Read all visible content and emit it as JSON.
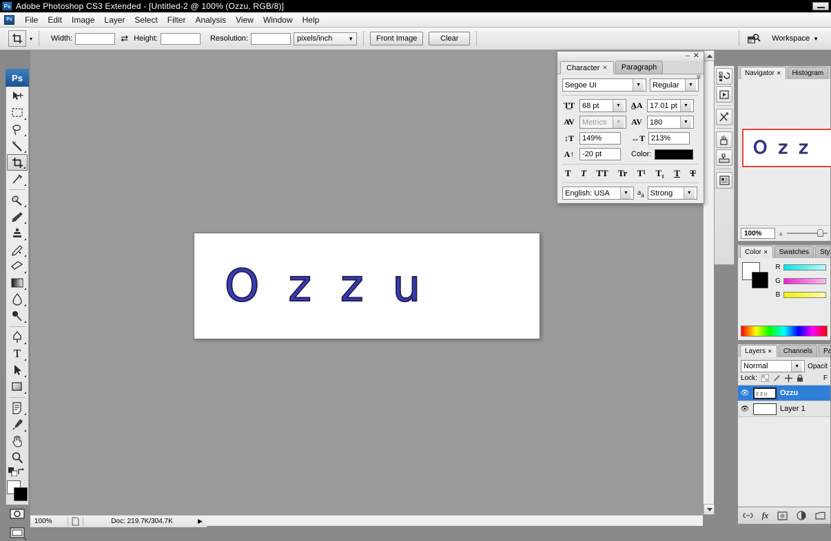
{
  "titlebar": {
    "logo": "Ps",
    "title": "Adobe Photoshop CS3 Extended - [Untitled-2 @ 100% (Ozzu, RGB/8)]",
    "minimize": "minimize-icon"
  },
  "menubar": {
    "logo": "Ps",
    "items": [
      "File",
      "Edit",
      "Image",
      "Layer",
      "Select",
      "Filter",
      "Analysis",
      "View",
      "Window",
      "Help"
    ]
  },
  "options_bar": {
    "tool_icon": "crop-tool-icon",
    "tool_caret": "▾",
    "width_label": "Width:",
    "width_value": "",
    "swap_icon": "⇄",
    "height_label": "Height:",
    "height_value": "",
    "resolution_label": "Resolution:",
    "resolution_value": "",
    "units": "pixels/inch",
    "front_image_label": "Front Image",
    "clear_label": "Clear",
    "bridge_icon": "bridge-icon",
    "workspace_label": "Workspace",
    "workspace_caret": "▼"
  },
  "toolbar": {
    "logo": "Ps",
    "tools": [
      {
        "name": "move-tool",
        "glyph": "➤",
        "selected": false,
        "has_flyout": false
      },
      {
        "name": "marquee-tool",
        "glyph": "▭",
        "selected": false,
        "has_flyout": true
      },
      {
        "name": "lasso-tool",
        "glyph": "◠",
        "selected": false,
        "has_flyout": true
      },
      {
        "name": "magic-wand-tool",
        "glyph": "✎",
        "selected": false,
        "has_flyout": true
      },
      {
        "name": "crop-tool",
        "glyph": "⌗",
        "selected": true,
        "has_flyout": true
      },
      {
        "name": "slice-tool",
        "glyph": "✂",
        "selected": false,
        "has_flyout": true
      },
      {
        "name": "healing-brush-tool",
        "glyph": "⊘",
        "selected": false,
        "has_flyout": true
      },
      {
        "name": "brush-tool",
        "glyph": "✒",
        "selected": false,
        "has_flyout": true
      },
      {
        "name": "clone-stamp-tool",
        "glyph": "♺",
        "selected": false,
        "has_flyout": true
      },
      {
        "name": "history-brush-tool",
        "glyph": "✧",
        "selected": false,
        "has_flyout": true
      },
      {
        "name": "eraser-tool",
        "glyph": "▱",
        "selected": false,
        "has_flyout": true
      },
      {
        "name": "gradient-tool",
        "glyph": "▦",
        "selected": false,
        "has_flyout": true
      },
      {
        "name": "blur-tool",
        "glyph": "💧",
        "selected": false,
        "has_flyout": true
      },
      {
        "name": "dodge-tool",
        "glyph": "⚲",
        "selected": false,
        "has_flyout": true
      },
      {
        "name": "pen-tool",
        "glyph": "✑",
        "selected": false,
        "has_flyout": true
      },
      {
        "name": "type-tool",
        "glyph": "T",
        "selected": false,
        "has_flyout": true
      },
      {
        "name": "path-selection-tool",
        "glyph": "➤",
        "selected": false,
        "has_flyout": true
      },
      {
        "name": "shape-tool",
        "glyph": "▢",
        "selected": false,
        "has_flyout": true
      },
      {
        "name": "notes-tool",
        "glyph": "▤",
        "selected": false,
        "has_flyout": true
      },
      {
        "name": "eyedropper-tool",
        "glyph": "⚲",
        "selected": false,
        "has_flyout": true
      },
      {
        "name": "hand-tool",
        "glyph": "✋",
        "selected": false,
        "has_flyout": false
      },
      {
        "name": "zoom-tool",
        "glyph": "🔍",
        "selected": false,
        "has_flyout": false
      }
    ],
    "foreground_color": "#ffffff",
    "background_color": "#000000",
    "default_colors_icon": "default-colors-icon",
    "swap_colors_icon": "swap-colors-icon",
    "quick_mask_icon": "quick-mask-icon",
    "screen_mode_icon": "screen-mode-icon"
  },
  "canvas": {
    "document_text": "Ozzu",
    "text_color": "#3b3bbe",
    "stroke_color": "#23234f",
    "background_color": "#9a9a9a"
  },
  "status_bar": {
    "zoom": "100%",
    "doc_icon": "document-icon",
    "doc_info": "Doc: 219.7K/304.7K",
    "arrow": "▶"
  },
  "character_panel": {
    "minimize": "–",
    "close": "✕",
    "menu_icon": "panel-menu-icon",
    "tabs": [
      {
        "label": "Character",
        "active": true,
        "closable": true
      },
      {
        "label": "Paragraph",
        "active": false,
        "closable": false
      }
    ],
    "font_family": "Segoe UI",
    "font_style": "Regular",
    "font_size_icon": "font-size-icon",
    "font_size": "68 pt",
    "leading_icon": "leading-icon",
    "leading": "17.01 pt",
    "kerning_icon": "kerning-icon",
    "kerning": "Metrics",
    "tracking_icon": "tracking-icon",
    "tracking": "180",
    "vscale_icon": "vertical-scale-icon",
    "vertical_scale": "149%",
    "hscale_icon": "horizontal-scale-icon",
    "horizontal_scale": "213%",
    "baseline_icon": "baseline-shift-icon",
    "baseline_shift": "-20 pt",
    "color_label": "Color:",
    "color_value": "#000000",
    "style_buttons": [
      "T",
      "T",
      "TT",
      "Tr",
      "T¹",
      "T₁",
      "T",
      "T"
    ],
    "language": "English: USA",
    "antialias_icon": "anti-alias-icon",
    "antialias": "Strong"
  },
  "dock_strip": {
    "buttons": [
      {
        "name": "history-panel-icon",
        "glyph": "↺"
      },
      {
        "name": "actions-panel-icon",
        "glyph": "▶"
      },
      {
        "name": "tool-presets-panel-icon",
        "glyph": "✂"
      },
      {
        "name": "brushes-panel-icon",
        "glyph": "🖌"
      },
      {
        "name": "clone-source-panel-icon",
        "glyph": "⎙"
      },
      {
        "name": "info-panel-icon",
        "glyph": "▤"
      }
    ]
  },
  "navigator_panel": {
    "tabs": [
      {
        "label": "Navigator",
        "active": true,
        "closable": true
      },
      {
        "label": "Histogram",
        "active": false,
        "closable": false
      }
    ],
    "thumbnail_text": "Ozz",
    "view_box_color": "#e8443c",
    "zoom": "100%",
    "zoom_out_icon": "zoom-out-icon",
    "zoom_in_icon": "zoom-in-icon"
  },
  "color_panel": {
    "tabs": [
      {
        "label": "Color",
        "active": true,
        "closable": true
      },
      {
        "label": "Swatches",
        "active": false,
        "closable": false
      },
      {
        "label": "Styl",
        "active": false,
        "closable": false
      }
    ],
    "channels": [
      {
        "label": "R",
        "gradient_start": "#00e8e8",
        "gradient_end": "#b8f7f7"
      },
      {
        "label": "G",
        "gradient_start": "#ee23d6",
        "gradient_end": "#f8b3ea"
      },
      {
        "label": "B",
        "gradient_start": "#f2f200",
        "gradient_end": "#fbfb9e"
      }
    ],
    "foreground": "#ffffff",
    "background": "#000000"
  },
  "layers_panel": {
    "tabs": [
      {
        "label": "Layers",
        "active": true,
        "closable": true
      },
      {
        "label": "Channels",
        "active": false,
        "closable": false
      },
      {
        "label": "Pat",
        "active": false,
        "closable": false
      }
    ],
    "blend_mode": "Normal",
    "opacity_label": "Opacit",
    "lock_label": "Lock:",
    "lock_icons": [
      "lock-transparency-icon",
      "lock-image-icon",
      "lock-position-icon",
      "lock-all-icon"
    ],
    "fill_label": "F",
    "layers": [
      {
        "name": "Ozzu",
        "visible": true,
        "selected": true,
        "type": "text"
      },
      {
        "name": "Layer 1",
        "visible": true,
        "selected": false,
        "type": "raster"
      }
    ],
    "footer_icons": [
      {
        "name": "link-layers-icon",
        "glyph": "🔗"
      },
      {
        "name": "layer-style-icon",
        "glyph": "fx"
      },
      {
        "name": "layer-mask-icon",
        "glyph": "◙"
      },
      {
        "name": "adjustment-layer-icon",
        "glyph": "◑"
      },
      {
        "name": "new-group-icon",
        "glyph": "▭"
      }
    ]
  }
}
